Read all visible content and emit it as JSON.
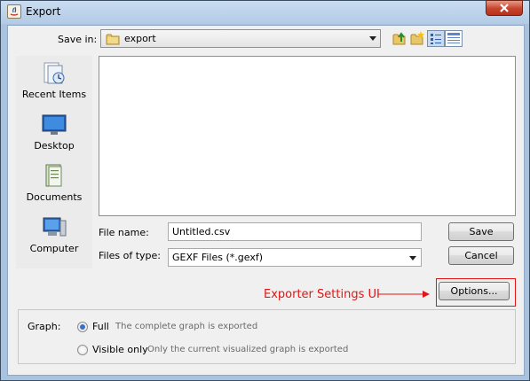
{
  "window": {
    "title": "Export"
  },
  "toolbar": {
    "save_in_label": "Save in:",
    "save_in_value": "export"
  },
  "places": [
    {
      "label": "Recent Items",
      "icon": "recent-items-icon"
    },
    {
      "label": "Desktop",
      "icon": "desktop-icon"
    },
    {
      "label": "Documents",
      "icon": "documents-icon"
    },
    {
      "label": "Computer",
      "icon": "computer-icon"
    }
  ],
  "form": {
    "file_name_label": "File name:",
    "file_name_value": "Untitled.csv",
    "files_of_type_label": "Files of type:",
    "files_of_type_value": "GEXF Files (*.gexf)",
    "save_label": "Save",
    "cancel_label": "Cancel"
  },
  "annotation": {
    "text": "Exporter Settings UI",
    "color": "#e31414"
  },
  "options": {
    "label": "Options..."
  },
  "graph": {
    "label": "Graph:",
    "options": [
      {
        "label": "Full",
        "description": "The complete graph is exported",
        "selected": true
      },
      {
        "label": "Visible only",
        "description": "Only the current visualized graph is exported",
        "selected": false
      }
    ]
  }
}
